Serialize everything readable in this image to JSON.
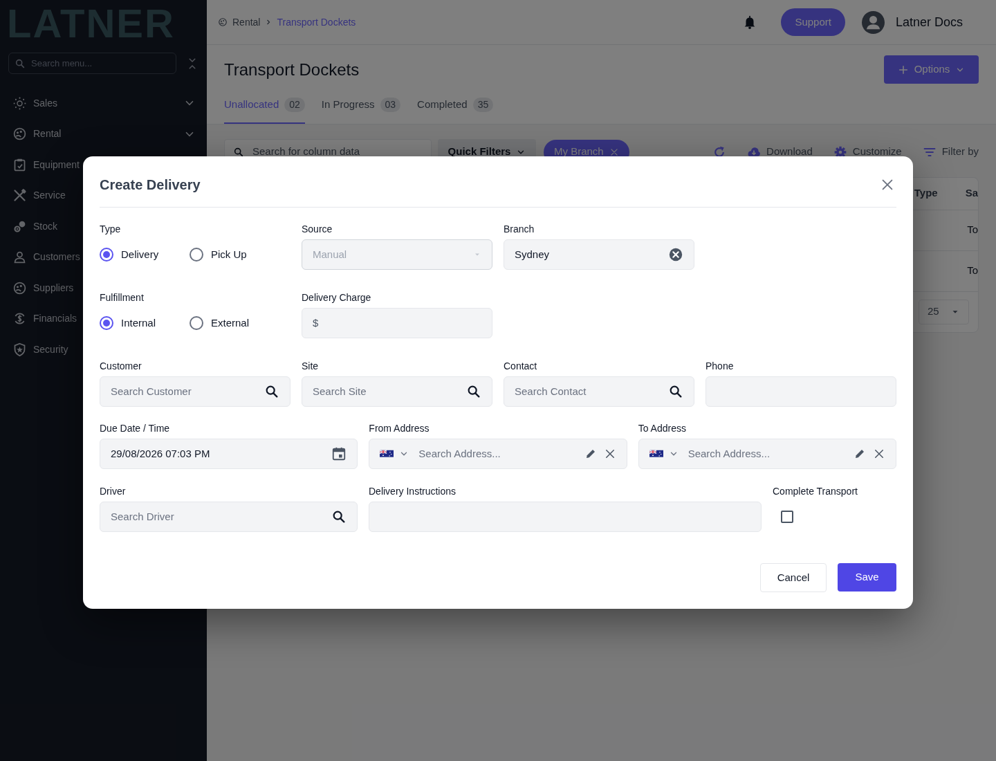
{
  "sidebar": {
    "logo": "LATNER",
    "search": {
      "placeholder": "Search menu..."
    },
    "items": [
      {
        "label": "Sales",
        "expandable": true
      },
      {
        "label": "Rental",
        "expandable": true
      },
      {
        "label": "Equipment"
      },
      {
        "label": "Service"
      },
      {
        "label": "Stock"
      },
      {
        "label": "Customers"
      },
      {
        "label": "Suppliers"
      },
      {
        "label": "Financials"
      },
      {
        "label": "Security"
      }
    ]
  },
  "header": {
    "breadcrumb": [
      "Rental",
      "Transport Dockets"
    ],
    "support": "Support",
    "user": "Latner Docs"
  },
  "page": {
    "title": "Transport Dockets",
    "options": "Options",
    "tabs": [
      {
        "label": "Unallocated",
        "count": "02",
        "selected": true
      },
      {
        "label": "In Progress",
        "count": "03",
        "selected": false
      },
      {
        "label": "Completed",
        "count": "35",
        "selected": false
      }
    ],
    "toolbar": {
      "search": {
        "placeholder": "Search for column data"
      },
      "quick_filters": "Quick Filters",
      "chip": "My Branch",
      "actions": [
        "Download",
        "Customize",
        "Filter by"
      ]
    },
    "table": {
      "columns": [
        "Type",
        "Sa"
      ],
      "rows": [
        {
          "column_2": "To"
        },
        {
          "column_2": "To"
        }
      ],
      "page_size": "25"
    }
  },
  "dialog": {
    "title": "Create Delivery",
    "type": {
      "label": "Type",
      "options": [
        {
          "label": "Delivery",
          "selected": true
        },
        {
          "label": "Pick Up",
          "selected": false
        }
      ]
    },
    "source": {
      "label": "Source",
      "value": "Manual",
      "disabled": true
    },
    "branch": {
      "label": "Branch",
      "value": "Sydney"
    },
    "fulfillment": {
      "label": "Fulfillment",
      "options": [
        {
          "label": "Internal",
          "selected": true
        },
        {
          "label": "External",
          "selected": false
        }
      ]
    },
    "delivery_charge": {
      "label": "Delivery Charge",
      "prefix": "$"
    },
    "customer": {
      "label": "Customer",
      "placeholder": "Search Customer"
    },
    "site": {
      "label": "Site",
      "placeholder": "Search Site"
    },
    "contact": {
      "label": "Contact",
      "placeholder": "Search Contact"
    },
    "phone": {
      "label": "Phone"
    },
    "due": {
      "label": "Due Date / Time",
      "value": "29/08/2026 07:03 PM"
    },
    "from_address": {
      "label": "From Address",
      "placeholder": "Search Address..."
    },
    "to_address": {
      "label": "To Address",
      "placeholder": "Search Address..."
    },
    "driver": {
      "label": "Driver",
      "placeholder": "Search Driver"
    },
    "instructions": {
      "label": "Delivery Instructions"
    },
    "complete": {
      "label": "Complete Transport",
      "checked": false
    },
    "buttons": {
      "cancel": "Cancel",
      "save": "Save"
    }
  }
}
